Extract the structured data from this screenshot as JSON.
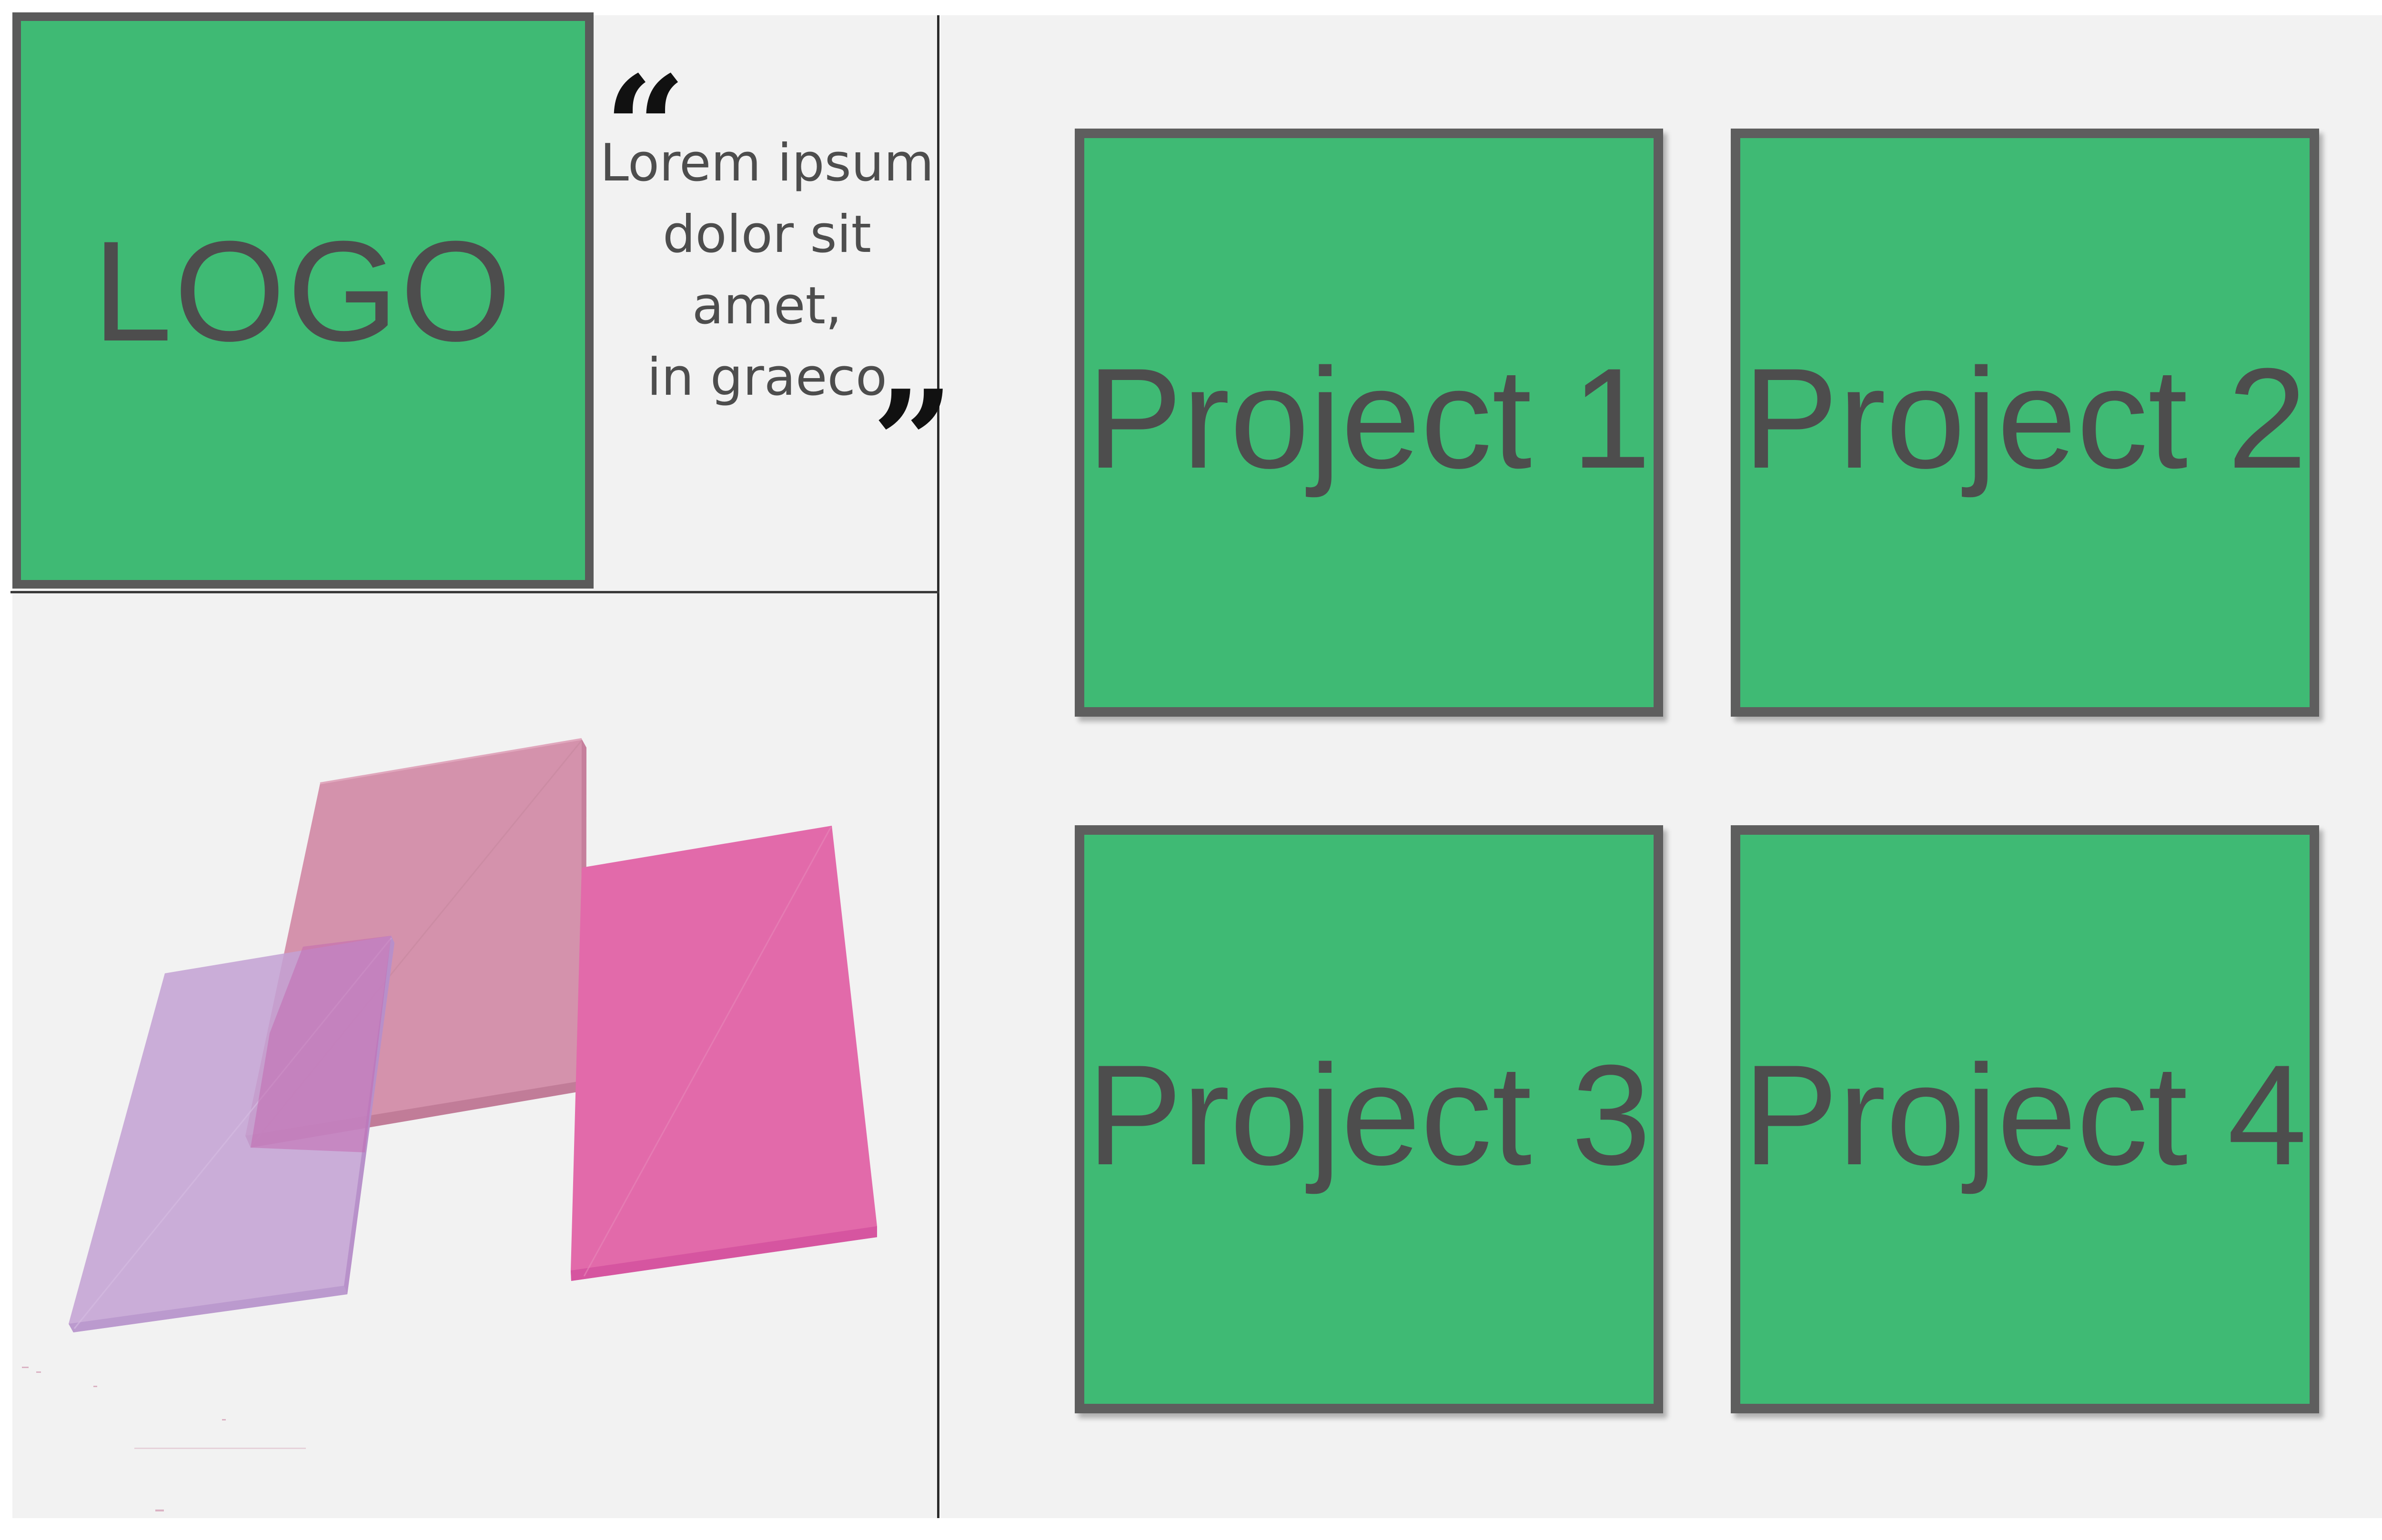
{
  "logo": {
    "text": "LOGO"
  },
  "quote": {
    "open_mark": "“",
    "close_mark": "”",
    "lines": [
      "Lorem ipsum",
      "dolor sit",
      "amet,",
      "in graeco"
    ]
  },
  "projects": [
    {
      "label": "Project 1"
    },
    {
      "label": "Project 2"
    },
    {
      "label": "Project 3"
    },
    {
      "label": "Project 4"
    }
  ],
  "colors": {
    "tile_fill": "#3fba74",
    "tile_border": "#5e5e5e",
    "text": "#4d4d4d",
    "panel_bg": "#f2f2f2",
    "shape_lavender": "#c3a1d3",
    "shape_rose": "#d28ca8",
    "shape_magenta": "#e26aaa"
  }
}
